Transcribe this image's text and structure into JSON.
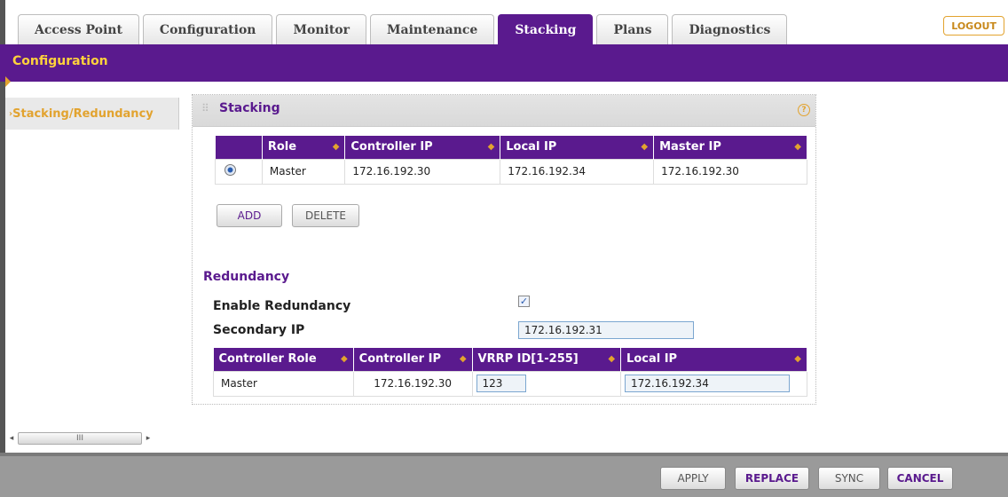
{
  "tabs": [
    "Access Point",
    "Configuration",
    "Monitor",
    "Maintenance",
    "Stacking",
    "Plans",
    "Diagnostics"
  ],
  "active_tab": "Stacking",
  "logout_label": "LOGOUT",
  "subnav_label": "Configuration",
  "sidebar": {
    "item_arrow": "›",
    "item_label": "Stacking/Redundancy"
  },
  "panel": {
    "title": "Stacking",
    "help": "?"
  },
  "stack_table": {
    "columns": [
      "Role",
      "Controller IP",
      "Local IP",
      "Master IP"
    ],
    "rows": [
      {
        "role": "Master",
        "controller_ip": "172.16.192.30",
        "local_ip": "172.16.192.34",
        "master_ip": "172.16.192.30",
        "selected": true
      }
    ]
  },
  "buttons": {
    "add": "ADD",
    "delete": "DELETE"
  },
  "redundancy": {
    "title": "Redundancy",
    "enable_label": "Enable Redundancy",
    "enable_checked": true,
    "check_mark": "✓",
    "secondary_ip_label": "Secondary IP",
    "secondary_ip": "172.16.192.31",
    "columns": [
      "Controller Role",
      "Controller IP",
      "VRRP ID[1-255]",
      "Local IP"
    ],
    "row": {
      "role": "Master",
      "controller_ip": "172.16.192.30",
      "vrrp_id": "123",
      "local_ip": "172.16.192.34"
    }
  },
  "scrollbar": {
    "left_arrow": "◂",
    "grip": "III",
    "right_arrow": "▸"
  },
  "footer": {
    "apply": "APPLY",
    "replace": "REPLACE",
    "sync": "SYNC",
    "cancel": "CANCEL"
  },
  "colors": {
    "brand_purple": "#5a1a8e",
    "accent_orange": "#e2a32f"
  }
}
